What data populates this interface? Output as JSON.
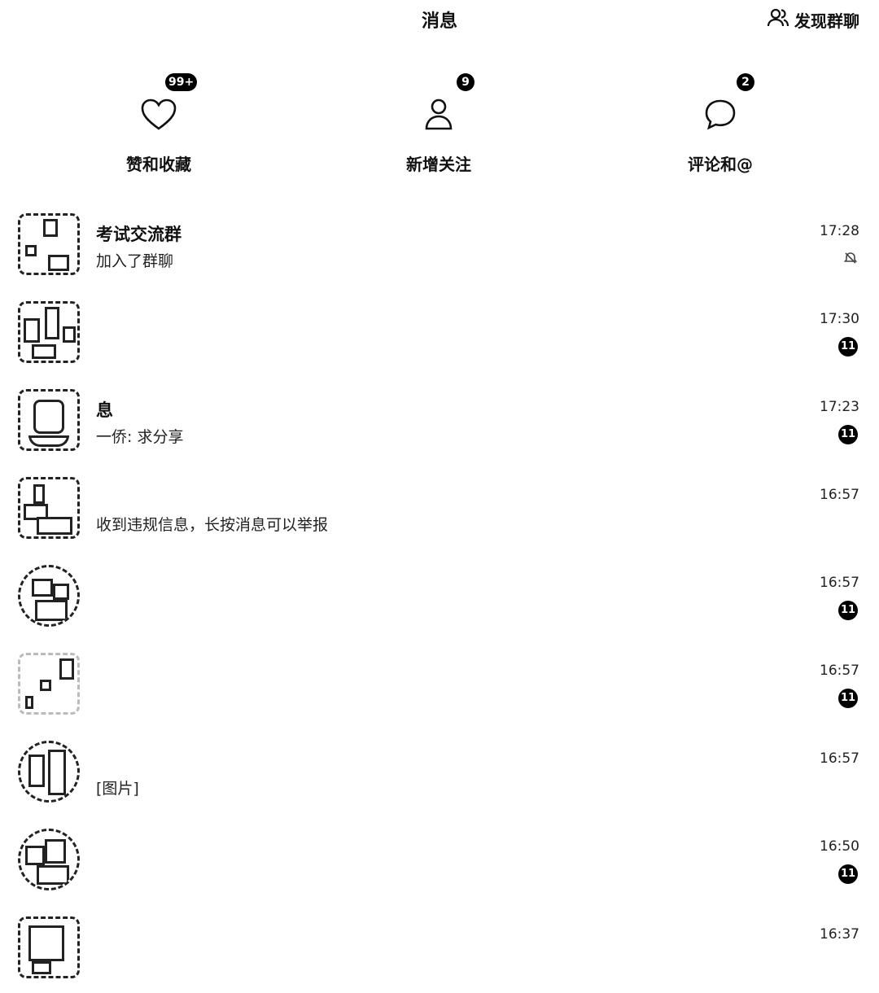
{
  "header": {
    "title": "消息",
    "discover_label": "发现群聊"
  },
  "quick_actions": [
    {
      "label": "赞和收藏",
      "badge": "99+",
      "icon": "heart-icon"
    },
    {
      "label": "新增关注",
      "badge": "9",
      "icon": "person-icon"
    },
    {
      "label": "评论和@",
      "badge": "2",
      "icon": "chat-bubble-icon"
    }
  ],
  "conversations": [
    {
      "name": "考试交流群",
      "preview": "加入了群聊",
      "time": "17:28",
      "badge": "",
      "muted": true
    },
    {
      "name": "",
      "preview": "",
      "time": "17:30",
      "badge": "11",
      "muted": false
    },
    {
      "name": "息",
      "preview": "一侨: 求分享",
      "time": "17:23",
      "badge": "11",
      "muted": false
    },
    {
      "name": "",
      "preview": "收到违规信息，长按消息可以举报",
      "time": "16:57",
      "badge": "",
      "muted": false
    },
    {
      "name": "",
      "preview": "",
      "time": "16:57",
      "badge": "11",
      "muted": false
    },
    {
      "name": "",
      "preview": "",
      "time": "16:57",
      "badge": "11",
      "muted": false
    },
    {
      "name": "",
      "preview": "[图片]",
      "time": "16:57",
      "badge": "",
      "muted": false
    },
    {
      "name": "",
      "preview": "",
      "time": "16:50",
      "badge": "11",
      "muted": false
    },
    {
      "name": "",
      "preview": "",
      "time": "16:37",
      "badge": "",
      "muted": false
    }
  ]
}
